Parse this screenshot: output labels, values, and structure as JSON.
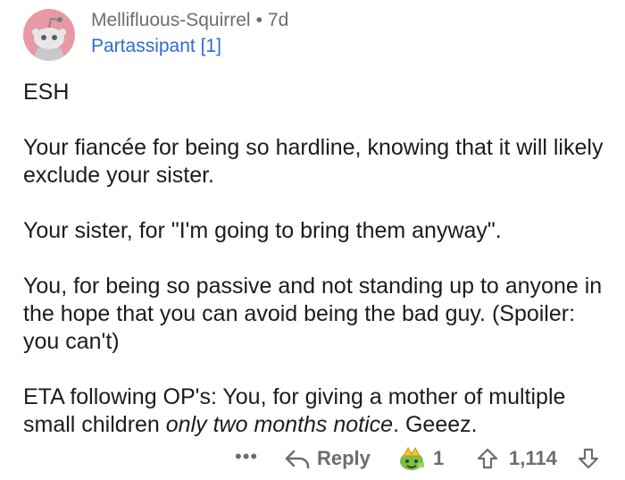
{
  "comment": {
    "username": "Mellifluous-Squirrel",
    "separator": "•",
    "age": "7d",
    "flair": "Partassipant [1]",
    "body": {
      "p1": "ESH",
      "p2": "Your fiancée for being so hardline, knowing that it will likely exclude your sister.",
      "p3": "Your sister, for \"I'm going to bring them anyway\".",
      "p4": "You, for being so passive and not standing up to anyone in the hope that you can avoid being the bad guy. (Spoiler: you can't)",
      "p5_pre": "ETA following OP's: You, for giving a mother of multiple small children ",
      "p5_em": "only two months notice",
      "p5_post": ". Geeez."
    }
  },
  "actions": {
    "more": "•••",
    "reply_label": "Reply",
    "award_count": "1",
    "score": "1,114"
  },
  "icons": {
    "avatar": "snoo-avatar-icon",
    "reply": "reply-arrow-icon",
    "award": "award-icon",
    "upvote": "upvote-arrow-icon",
    "downvote": "downvote-arrow-icon"
  },
  "colors": {
    "text": "#1c1c1c",
    "muted": "#6a6d72",
    "flair": "#2c6cd1",
    "avatar_bg": "#e89aa4"
  }
}
